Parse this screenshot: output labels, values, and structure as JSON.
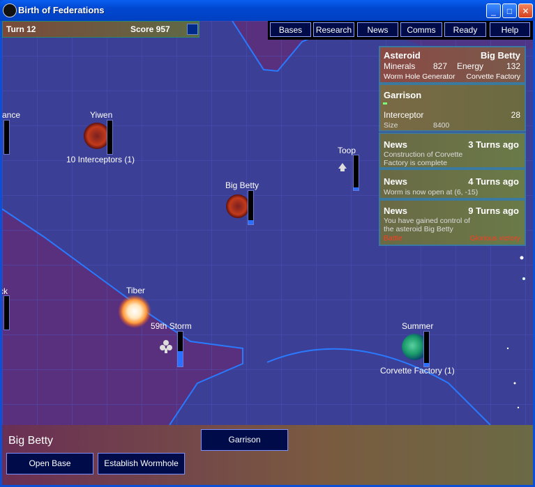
{
  "window": {
    "title": "Birth of Federations",
    "icon_text": "BoF"
  },
  "topinfo": {
    "turn": "Turn 12",
    "score": "Score 957"
  },
  "menu": {
    "bases": "Bases",
    "research": "Research",
    "news": "News",
    "comms": "Comms",
    "ready": "Ready",
    "help": "Help"
  },
  "panel_asteroid": {
    "heading": "Asteroid",
    "name": "Big Betty",
    "minerals_label": "Minerals",
    "minerals_value": "827",
    "energy_label": "Energy",
    "energy_value": "132",
    "building1": "Worm Hole Generator",
    "building2": "Corvette Factory"
  },
  "panel_garrison": {
    "heading": "Garrison",
    "unit": "Interceptor",
    "count": "28",
    "size_label": "Size",
    "size_value": "8400"
  },
  "news": [
    {
      "heading": "News",
      "age": "3 Turns ago",
      "line1": "Construction of  Corvette",
      "line2": "Factory is complete"
    },
    {
      "heading": "News",
      "age": "4 Turns ago",
      "line1": "Worm is now open at (6, -15)"
    },
    {
      "heading": "News",
      "age": "9 Turns ago",
      "line1": "You have gained control of",
      "line2": "the asteroid Big Betty",
      "action_left": "Battle",
      "action_right": "Glorious victory"
    }
  ],
  "map": {
    "yiwen": {
      "name": "Yiwen",
      "sub": "10 Interceptors (1)"
    },
    "big_betty": {
      "name": "Big Betty"
    },
    "toop": {
      "name": "Toop"
    },
    "tiber": {
      "name": "Tiber"
    },
    "storm": {
      "name": "59th Storm"
    },
    "summer": {
      "name": "Summer",
      "sub": "Corvette Factory (1)"
    },
    "edge_top": {
      "name": "rance"
    },
    "edge_bottom": {
      "name": "ck"
    }
  },
  "bottom": {
    "selected": "Big Betty",
    "garrison": "Garrison",
    "open_base": "Open Base",
    "establish_wormhole": "Establish Wormhole"
  },
  "colors": {
    "accent": "#2a6fff",
    "panel_border": "#3a7aa0",
    "battle": "#ff3b1f"
  }
}
